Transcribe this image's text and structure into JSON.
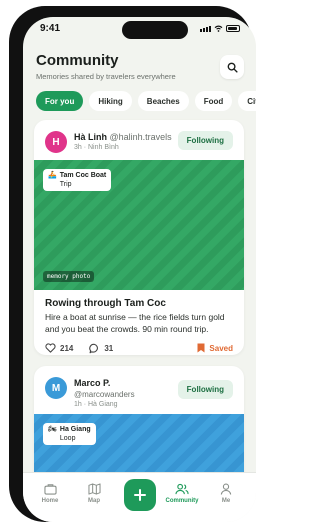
{
  "status": {
    "time": "9:41"
  },
  "header": {
    "title": "Community",
    "subtitle": "Memories shared by travelers everywhere"
  },
  "chips": [
    {
      "label": "For you",
      "active": true
    },
    {
      "label": "Hiking"
    },
    {
      "label": "Beaches"
    },
    {
      "label": "Food"
    },
    {
      "label": "City"
    }
  ],
  "posts": [
    {
      "avatar_initial": "H",
      "avatar_color": "#e0348a",
      "name": "Hà Linh",
      "handle": "@halinh.travels",
      "meta": "3h · Ninh Bình",
      "follow_label": "Following",
      "place_icon": "boat-emoji",
      "place_line1": "Tam Coc Boat",
      "place_line2": "Trip",
      "badge": "memory photo",
      "title": "Rowing through Tam Coc",
      "body": "Hire a boat at sunrise — the rice fields turn gold and you beat the crowds. 90 min round trip.",
      "likes": "214",
      "comments": "31",
      "saved_label": "Saved"
    },
    {
      "avatar_initial": "M",
      "avatar_color": "#3a9ad8",
      "name": "Marco P.",
      "handle": "@marcowanders",
      "meta": "1h · Hà Giang",
      "follow_label": "Following",
      "place_icon": "motorbike-emoji",
      "place_line1": "Ha Giang",
      "place_line2": "Loop"
    }
  ],
  "tabs": [
    {
      "label": "Home",
      "icon": "bag-icon"
    },
    {
      "label": "Map",
      "icon": "map-icon"
    },
    {
      "label": "Community",
      "icon": "people-icon",
      "active": true
    },
    {
      "label": "Me",
      "icon": "person-icon"
    }
  ],
  "colors": {
    "accent": "#1e9a5a",
    "saved": "#e06a34"
  }
}
